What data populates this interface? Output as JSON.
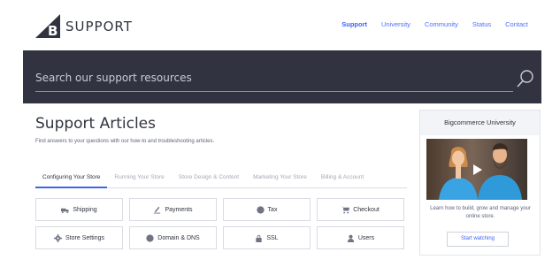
{
  "brand": {
    "logo_letter": "B",
    "name": "SUPPORT",
    "accent": "#3c64f4",
    "dark": "#313440"
  },
  "nav": {
    "items": [
      {
        "label": "Support",
        "active": true
      },
      {
        "label": "University",
        "active": false
      },
      {
        "label": "Community",
        "active": false
      },
      {
        "label": "Status",
        "active": false
      },
      {
        "label": "Contact",
        "active": false
      }
    ]
  },
  "search": {
    "placeholder": "Search our support resources",
    "icon": "search-icon"
  },
  "main": {
    "title": "Support Articles",
    "subtitle": "Find answers to your questions with our how-to and troubleshooting articles.",
    "tabs": [
      {
        "label": "Configuring Your Store",
        "active": true
      },
      {
        "label": "Running Your Store",
        "active": false
      },
      {
        "label": "Store Design & Content",
        "active": false
      },
      {
        "label": "Marketing Your Store",
        "active": false
      },
      {
        "label": "Billing & Account",
        "active": false
      }
    ],
    "categories": [
      {
        "label": "Shipping",
        "icon": "truck-icon"
      },
      {
        "label": "Payments",
        "icon": "payment-icon"
      },
      {
        "label": "Tax",
        "icon": "tax-icon"
      },
      {
        "label": "Checkout",
        "icon": "cart-icon"
      },
      {
        "label": "Store Settings",
        "icon": "gear-icon"
      },
      {
        "label": "Domain & DNS",
        "icon": "globe-icon"
      },
      {
        "label": "SSL",
        "icon": "lock-icon"
      },
      {
        "label": "Users",
        "icon": "users-icon"
      }
    ]
  },
  "sidebar": {
    "title": "Bigcommerce University",
    "description": "Learn how to build, grow and manage your online store.",
    "button_label": "Start watching"
  }
}
